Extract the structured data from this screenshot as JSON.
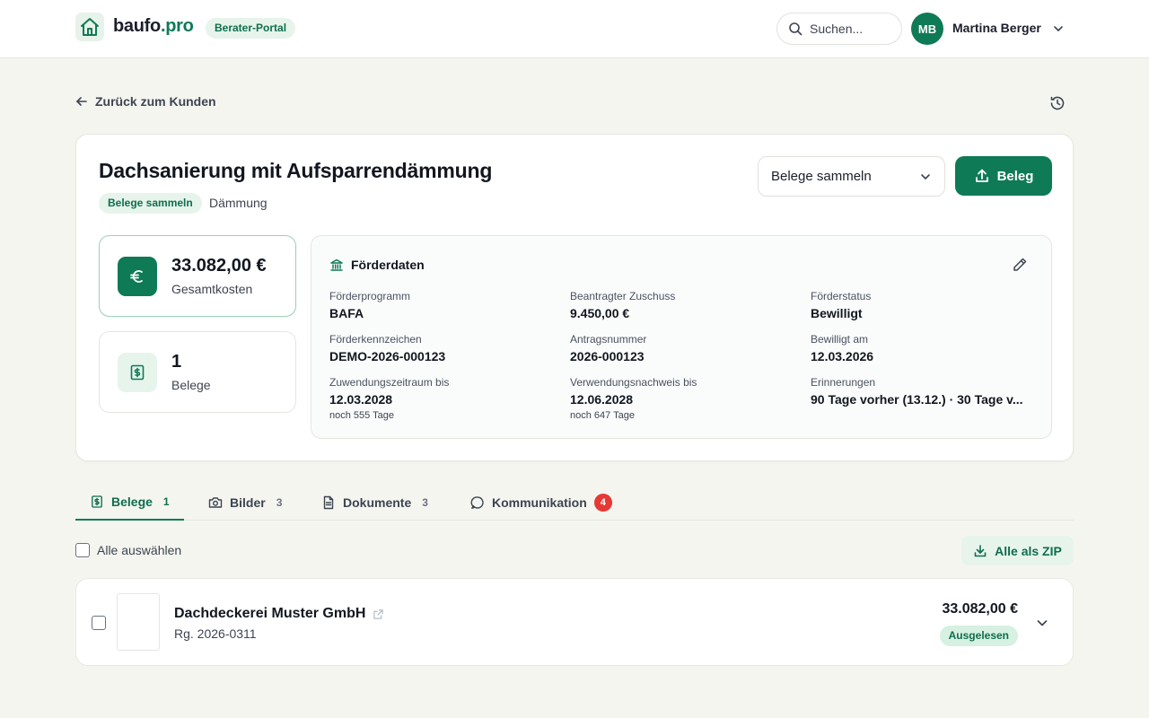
{
  "header": {
    "brand_name": "baufo",
    "brand_tld": ".pro",
    "portal_badge": "Berater-Portal",
    "search_placeholder": "Suchen...",
    "user_initials": "MB",
    "user_name": "Martina Berger"
  },
  "nav": {
    "back_label": "Zurück zum Kunden"
  },
  "project": {
    "title": "Dachsanierung mit Aufsparrendämmung",
    "status_badge": "Belege sammeln",
    "category": "Dämmung",
    "status_select": "Belege sammeln",
    "upload_label": "Beleg"
  },
  "stats": [
    {
      "value": "33.082,00 €",
      "label": "Gesamtkosten",
      "icon": "euro-icon"
    },
    {
      "value": "1",
      "label": "Belege",
      "icon": "receipt-icon"
    }
  ],
  "funding": {
    "title": "Förderdaten",
    "fields": {
      "program": {
        "label": "Förderprogramm",
        "value": "BAFA"
      },
      "requested": {
        "label": "Beantragter Zuschuss",
        "value": "9.450,00 €"
      },
      "status": {
        "label": "Förderstatus",
        "value": "Bewilligt"
      },
      "reference": {
        "label": "Förderkennzeichen",
        "value": "DEMO-2026-000123"
      },
      "application": {
        "label": "Antragsnummer",
        "value": "2026-000123"
      },
      "approved_on": {
        "label": "Bewilligt am",
        "value": "12.03.2026"
      },
      "grant_period": {
        "label": "Zuwendungszeitraum bis",
        "value": "12.03.2028",
        "sub": "noch 555 Tage"
      },
      "proof_due": {
        "label": "Verwendungsnachweis bis",
        "value": "12.06.2028",
        "sub": "noch 647 Tage"
      },
      "reminders": {
        "label": "Erinnerungen",
        "value": "90 Tage vorher (13.12.) · 30 Tage v..."
      }
    }
  },
  "tabs": [
    {
      "label": "Belege",
      "count": "1",
      "icon": "receipt-icon",
      "active": true
    },
    {
      "label": "Bilder",
      "count": "3",
      "icon": "camera-icon"
    },
    {
      "label": "Dokumente",
      "count": "3",
      "icon": "document-icon"
    },
    {
      "label": "Kommunikation",
      "count": "4",
      "icon": "chat-icon"
    }
  ],
  "list": {
    "select_all_label": "Alle auswählen",
    "zip_label": "Alle als ZIP",
    "items": [
      {
        "vendor": "Dachdeckerei Muster GmbH",
        "invoice": "Rg. 2026-0311",
        "amount": "33.082,00 €",
        "status": "Ausgelesen"
      }
    ]
  },
  "colors": {
    "brand": "#0f7a56",
    "brand_soft": "#e6f4ec",
    "alert": "#e53935",
    "background": "#f5f5f0"
  }
}
